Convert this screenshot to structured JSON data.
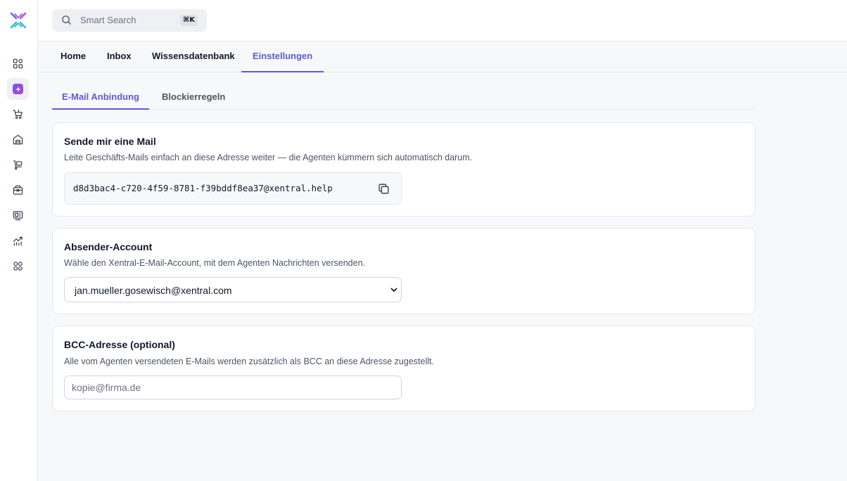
{
  "colors": {
    "accent": "#5b5bd6",
    "background": "#f7f8fa",
    "border": "#e5e7eb"
  },
  "sidebar": {
    "logo": "xentral-logo",
    "icons": [
      "dashboard-grid-icon",
      "ai-app-icon",
      "shopping-cart-icon",
      "warehouse-icon",
      "delivery-icon",
      "inventory-icon",
      "pos-terminal-icon",
      "analytics-icon",
      "apps-icon"
    ]
  },
  "search": {
    "placeholder": "Smart Search",
    "shortcut": "⌘K"
  },
  "nav": {
    "tabs": [
      {
        "label": "Home",
        "active": false
      },
      {
        "label": "Inbox",
        "active": false
      },
      {
        "label": "Wissensdatenbank",
        "active": false
      },
      {
        "label": "Einstellungen",
        "active": true
      }
    ]
  },
  "sub_tabs": [
    {
      "label": "E-Mail Anbindung",
      "active": true
    },
    {
      "label": "Blockierregeln",
      "active": false
    }
  ],
  "send_card": {
    "title": "Sende mir eine Mail",
    "description": "Leite Geschäfts-Mails einfach an diese Adresse weiter — die Agenten kümmern sich automatisch darum.",
    "address": "d8d3bac4-c720-4f59-8781-f39bddf8ea37@xentral.help"
  },
  "sender_card": {
    "title": "Absender-Account",
    "description": "Wähle den Xentral-E-Mail-Account, mit dem Agenten Nachrichten versenden.",
    "selected": "jan.mueller.gosewisch@xentral.com"
  },
  "bcc_card": {
    "title": "BCC-Adresse (optional)",
    "description": "Alle vom Agenten versendeten E-Mails werden zusätzlich als BCC an diese Adresse zugestellt.",
    "placeholder": "kopie@firma.de",
    "value": ""
  }
}
